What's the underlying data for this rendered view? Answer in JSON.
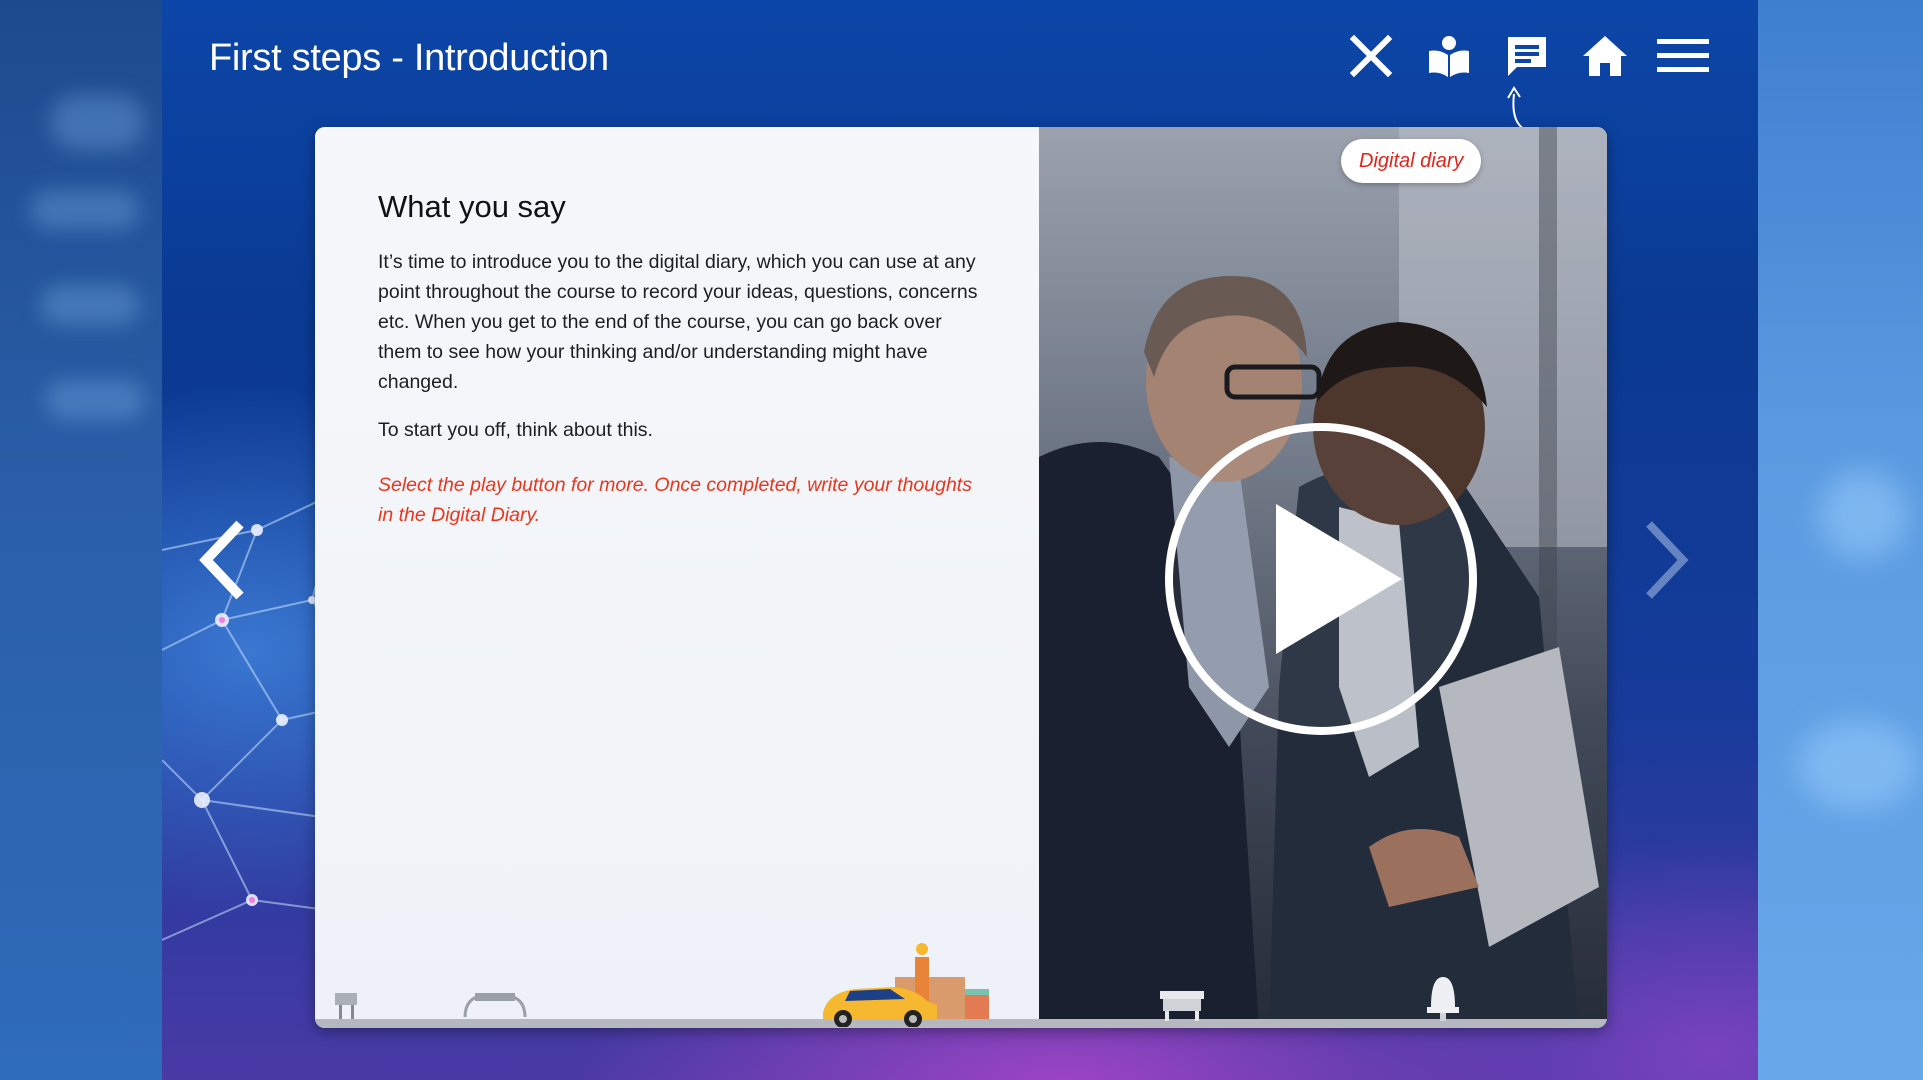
{
  "header": {
    "title": "First steps - Introduction"
  },
  "toolbar": {
    "buttons": [
      {
        "name": "close",
        "icon": "close-icon"
      },
      {
        "name": "glossary",
        "icon": "book-reader-icon"
      },
      {
        "name": "digital-diary",
        "icon": "chat-bubble-icon"
      },
      {
        "name": "home",
        "icon": "home-icon"
      },
      {
        "name": "menu",
        "icon": "hamburger-menu-icon"
      }
    ]
  },
  "content": {
    "heading": "What you say",
    "body": "It’s time to introduce you to the digital diary, which you can use at any point throughout the course to record your ideas, questions, concerns etc. When you get to the end of the course, you can go back over them to see how your thinking and/or understanding might have changed.",
    "prompt": "To start you off, think about this.",
    "instruction": "Select the play button for more. Once completed, write your thoughts in the Digital Diary."
  },
  "media": {
    "diary_button_label": "Digital diary",
    "play_icon": "play-icon"
  },
  "navigation": {
    "prev_icon": "chevron-left-icon",
    "next_icon": "chevron-right-icon"
  },
  "colors": {
    "accent_red": "#e8371d",
    "header_text": "#ffffff",
    "background_blue": "#0c46a8"
  }
}
